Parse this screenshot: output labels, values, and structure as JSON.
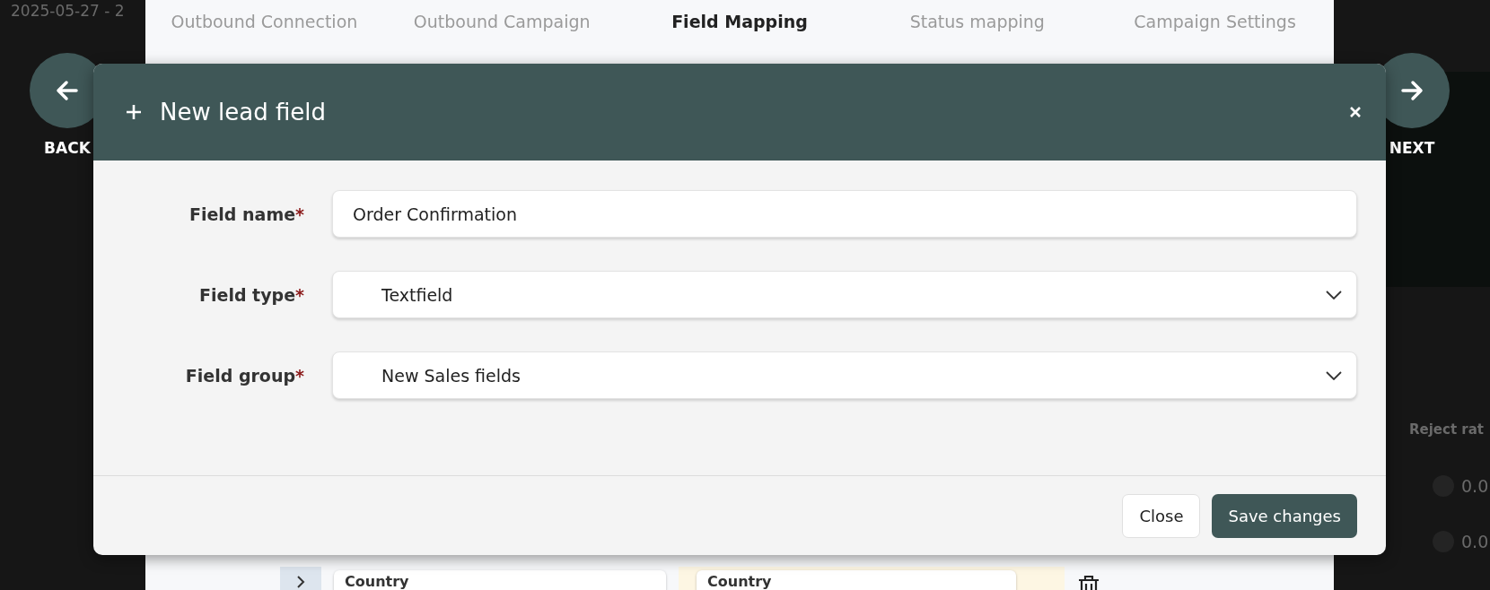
{
  "background": {
    "date_range": "2025-05-27 - 2",
    "tabs": [
      {
        "label": "Outbound Connection",
        "selected": false
      },
      {
        "label": "Outbound Campaign",
        "selected": false
      },
      {
        "label": "Field Mapping",
        "selected": true
      },
      {
        "label": "Status mapping",
        "selected": false
      },
      {
        "label": "Campaign Settings",
        "selected": false
      }
    ],
    "back_button": {
      "label": "BACK"
    },
    "next_button": {
      "label": "NEXT"
    },
    "table_header": "Reject rat",
    "table_rows": [
      {
        "value": "0.0"
      },
      {
        "value": "0.0"
      }
    ],
    "mapping_row": {
      "left": "Country",
      "right": "Country"
    }
  },
  "modal": {
    "title": "New lead field",
    "fields": [
      {
        "kind": "text",
        "label": "Field name",
        "required_mark": "*",
        "value": "Order Confirmation"
      },
      {
        "kind": "select",
        "label": "Field type",
        "required_mark": "*",
        "value": "Textfield"
      },
      {
        "kind": "select",
        "label": "Field group",
        "required_mark": "*",
        "value": "New Sales fields"
      }
    ],
    "buttons": [
      {
        "kind": "secondary",
        "label": "Close"
      },
      {
        "kind": "primary",
        "label": "Save changes"
      }
    ]
  }
}
